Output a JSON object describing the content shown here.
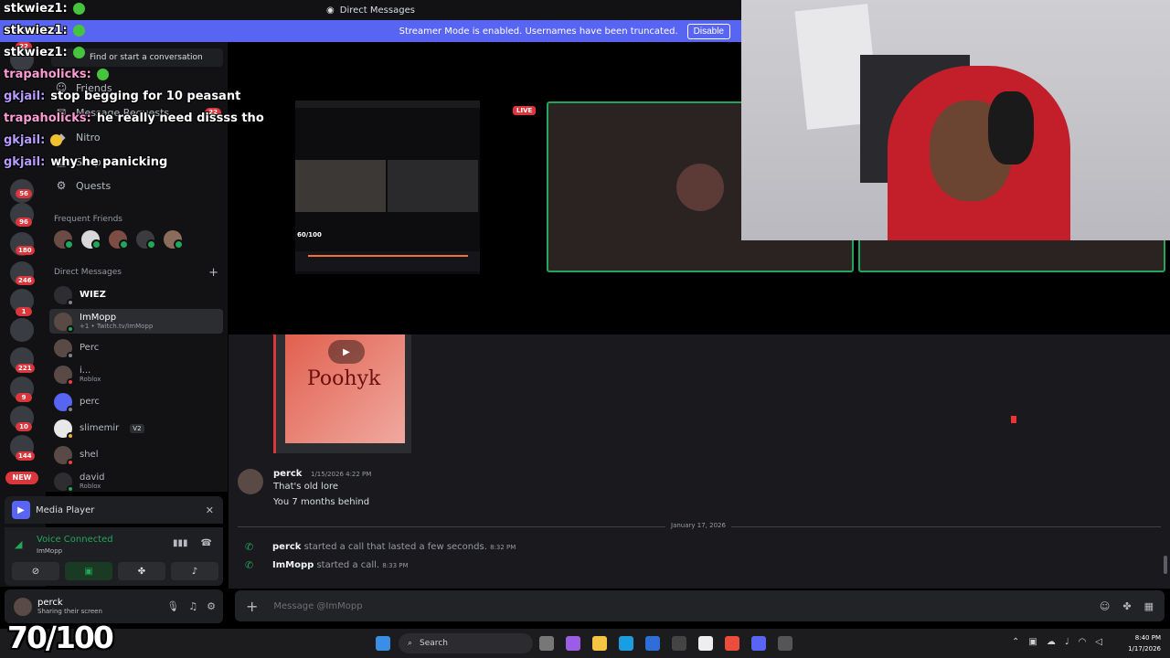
{
  "window": {
    "title": "Direct Messages"
  },
  "streamer_banner": {
    "text": "Streamer Mode is enabled. Usernames have been truncated.",
    "button": "Disable"
  },
  "rail": {
    "badges": [
      "22",
      "56",
      "96",
      "180",
      "246",
      "1",
      "221",
      "9",
      "10",
      "144"
    ],
    "new_badge": "NEW"
  },
  "sidebar": {
    "search_placeholder": "Find or start a conversation",
    "nav": [
      {
        "label": "Friends",
        "icon": "friends-icon"
      },
      {
        "label": "Message Requests",
        "icon": "mail-icon",
        "count": "22"
      },
      {
        "label": "Nitro",
        "icon": "nitro-icon"
      },
      {
        "label": "Shop",
        "icon": "shop-icon"
      },
      {
        "label": "Quests",
        "icon": "quests-icon"
      }
    ],
    "frequent_title": "Frequent Friends",
    "dm_title": "Direct Messages",
    "dms": [
      {
        "name": "WIEZ",
        "sub": "",
        "tag": ""
      },
      {
        "name": "ImMopp",
        "sub": "+1 • Twitch.tv/ImMopp",
        "tag": ""
      },
      {
        "name": "Perc",
        "sub": "",
        "tag": ""
      },
      {
        "name": "i...",
        "sub": "Roblox",
        "tag": ""
      },
      {
        "name": "perc",
        "sub": "",
        "tag": ""
      },
      {
        "name": "slimemir",
        "sub": "",
        "tag": "V2"
      },
      {
        "name": "shel",
        "sub": "",
        "tag": ""
      },
      {
        "name": "david",
        "sub": "Roblox",
        "tag": ""
      }
    ]
  },
  "media_player": {
    "label": "Media Player"
  },
  "voice": {
    "status": "Voice Connected",
    "channel": "ImMopp"
  },
  "user": {
    "name": "perck",
    "status": "Sharing their screen"
  },
  "stream": {
    "live": "LIVE",
    "mini_score": "60/100"
  },
  "chat": {
    "embed_text": "Poohyk",
    "message": {
      "author": "perck",
      "timestamp": "1/15/2026 4:22 PM",
      "lines": [
        "That's old lore",
        "You 7 months behind"
      ]
    },
    "divider": "January 17, 2026",
    "system": [
      {
        "user": "perck",
        "text": "started a call that lasted a few seconds.",
        "time": "8:32 PM"
      },
      {
        "user": "ImMopp",
        "text": "started a call.",
        "time": "8:33 PM"
      }
    ],
    "composer_placeholder": "Message @ImMopp"
  },
  "taskbar": {
    "search": "Search",
    "time": "8:40 PM",
    "date": "1/17/2026"
  },
  "overlay_chat": [
    {
      "user": "stkwiez1:",
      "text": "",
      "color": "#ffffff"
    },
    {
      "user": "stkwiez1:",
      "text": "",
      "color": "#ffffff"
    },
    {
      "user": "stkwiez1:",
      "text": "",
      "color": "#ffffff"
    },
    {
      "user": "trapaholicks:",
      "text": "",
      "color": "#ff9bd6"
    },
    {
      "user": "gkjail:",
      "text": "stop begging for 10 peasant",
      "color": "#b89cff"
    },
    {
      "user": "trapaholicks:",
      "text": "he really need dissss tho",
      "color": "#ff9bd6"
    },
    {
      "user": "gkjail:",
      "text": "",
      "color": "#b89cff"
    },
    {
      "user": "gkjail:",
      "text": "why he panicking",
      "color": "#b89cff"
    }
  ],
  "score_overlay": "70/100"
}
